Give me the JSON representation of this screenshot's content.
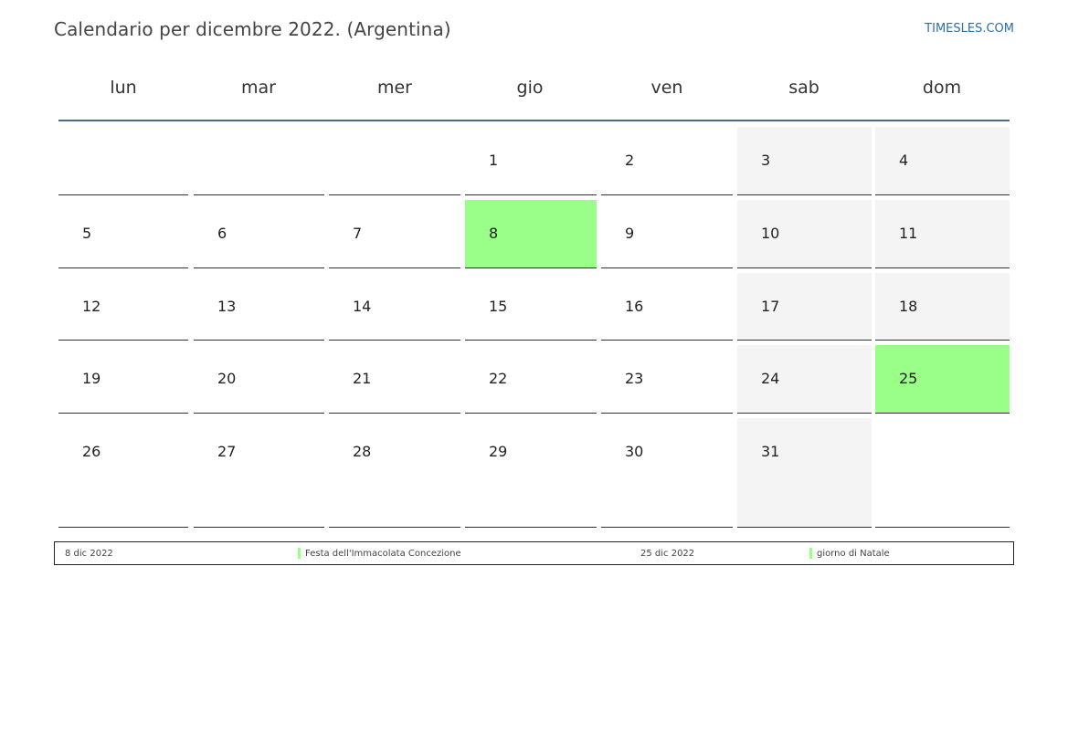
{
  "header": {
    "title": "Calendario per dicembre 2022. (Argentina)",
    "site": "TIMESLES.COM"
  },
  "weekdays": [
    "lun",
    "mar",
    "mer",
    "gio",
    "ven",
    "sab",
    "dom"
  ],
  "calendar": {
    "weeks": [
      [
        "",
        "",
        "",
        "1",
        "2",
        "3",
        "4"
      ],
      [
        "5",
        "6",
        "7",
        "8",
        "9",
        "10",
        "11"
      ],
      [
        "12",
        "13",
        "14",
        "15",
        "16",
        "17",
        "18"
      ],
      [
        "19",
        "20",
        "21",
        "22",
        "23",
        "24",
        "25"
      ],
      [
        "26",
        "27",
        "28",
        "29",
        "30",
        "31",
        ""
      ]
    ],
    "holidays": [
      "8",
      "25"
    ]
  },
  "legend": {
    "items": [
      {
        "date": "8 dic 2022",
        "name": "Festa dell'Immacolata Concezione"
      },
      {
        "date": "25 dic 2022",
        "name": "giorno di Natale"
      }
    ]
  },
  "colors": {
    "holiday": "#99ff88",
    "weekend": "#f4f4f4",
    "header_line": "#4a6890",
    "link": "#2f6ea8"
  }
}
